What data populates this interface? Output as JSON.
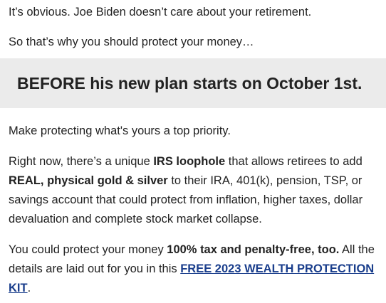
{
  "paragraph1": "It’s obvious. Joe Biden doesn’t care about your retirement.",
  "paragraph2": "So that’s why you should protect your money…",
  "banner": {
    "text": "BEFORE his new plan starts on October 1st.",
    "background": "#ebebeb"
  },
  "paragraph3": "Make protecting what's yours a top priority.",
  "paragraph4": {
    "part1": "Right now, there’s a unique ",
    "bold1": "IRS loophole",
    "part2": " that allows retirees to add ",
    "bold2": "REAL, physical gold & silver",
    "part3": " to their IRA, 401(k), pension, TSP, or savings account that could protect from inflation, higher taxes, dollar devaluation and complete stock market collapse."
  },
  "paragraph5": {
    "part1": "You could protect your money ",
    "bold1": "100% tax and penalty-free, too.",
    "part2": " All the details are laid out for you in this ",
    "link": "FREE 2023 WEALTH PROTECTION KIT",
    "part3": "."
  },
  "colors": {
    "text": "#222222",
    "link": "#1a3e8c"
  }
}
